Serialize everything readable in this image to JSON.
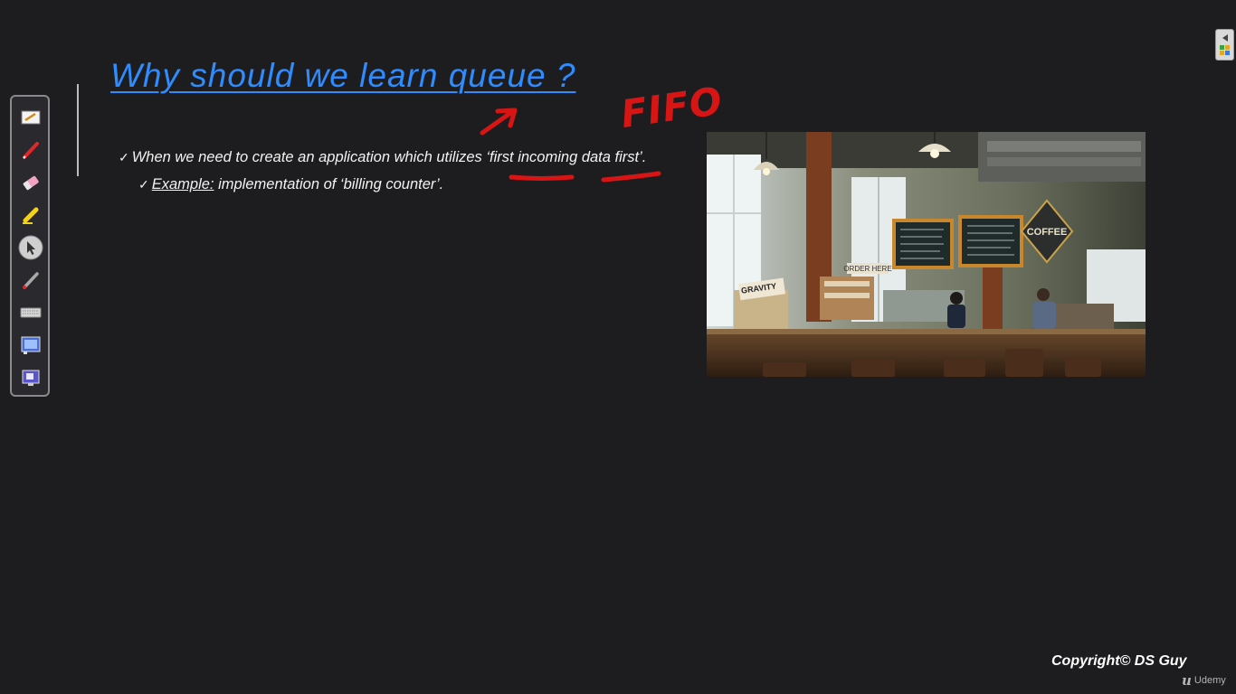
{
  "slide": {
    "title": "Why should we learn queue ?",
    "bullets": [
      {
        "check": "✓",
        "text_before": "When we need to create an application which utilizes ‘",
        "highlight": "first incoming data first",
        "text_after": "’."
      },
      {
        "check": "✓",
        "label": "Example:",
        "text": " implementation of ‘billing counter’."
      }
    ],
    "photo_signs": {
      "coffee": "COFFEE",
      "order_here": "ORDER HERE",
      "gravity": "GRAVITY"
    }
  },
  "annotations": {
    "handwritten_text": "FIFO",
    "ink_color": "#d81515"
  },
  "toolbar": {
    "tools": [
      {
        "icon": "whiteboard-icon"
      },
      {
        "icon": "pen-icon"
      },
      {
        "icon": "eraser-icon"
      },
      {
        "icon": "highlighter-icon"
      },
      {
        "icon": "pointer-icon",
        "selected": true
      },
      {
        "icon": "laser-pen-icon"
      },
      {
        "icon": "keyboard-icon"
      },
      {
        "icon": "screen-capture-icon"
      },
      {
        "icon": "display-icon"
      }
    ]
  },
  "footer": {
    "copyright": "Copyright© DS Guy",
    "brand": "Udemy"
  },
  "colors": {
    "background": "#1d1d20",
    "title": "#2f8cff",
    "body_text": "#f2f2f2",
    "ink": "#d81515"
  }
}
